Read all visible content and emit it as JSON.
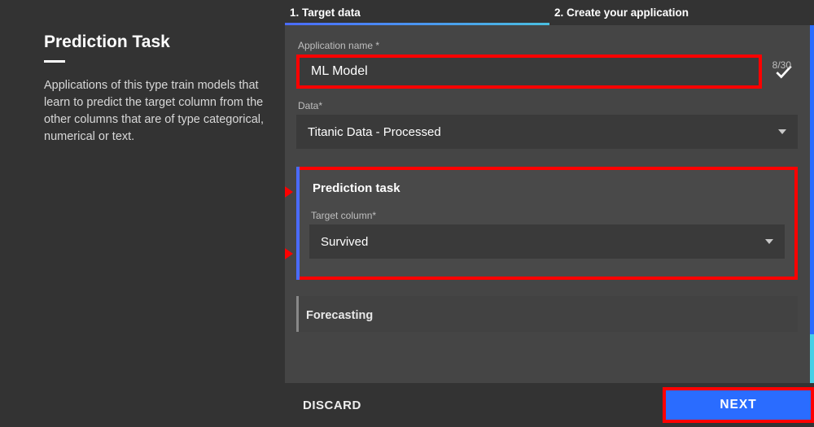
{
  "sidebar": {
    "title": "Prediction Task",
    "description": "Applications of this type train models that learn to predict the target column from the other columns that are of type categorical, numerical or text."
  },
  "steps": {
    "step1": "1. Target data",
    "step2": "2. Create your application"
  },
  "form": {
    "appname_label": "Application name *",
    "appname_value": "ML Model",
    "appname_counter": "8/30",
    "data_label": "Data*",
    "data_value": "Titanic Data - Processed",
    "prediction_card_title": "Prediction task",
    "target_label": "Target column*",
    "target_value": "Survived",
    "forecasting_title": "Forecasting"
  },
  "footer": {
    "discard": "DISCARD",
    "next": "NEXT"
  }
}
